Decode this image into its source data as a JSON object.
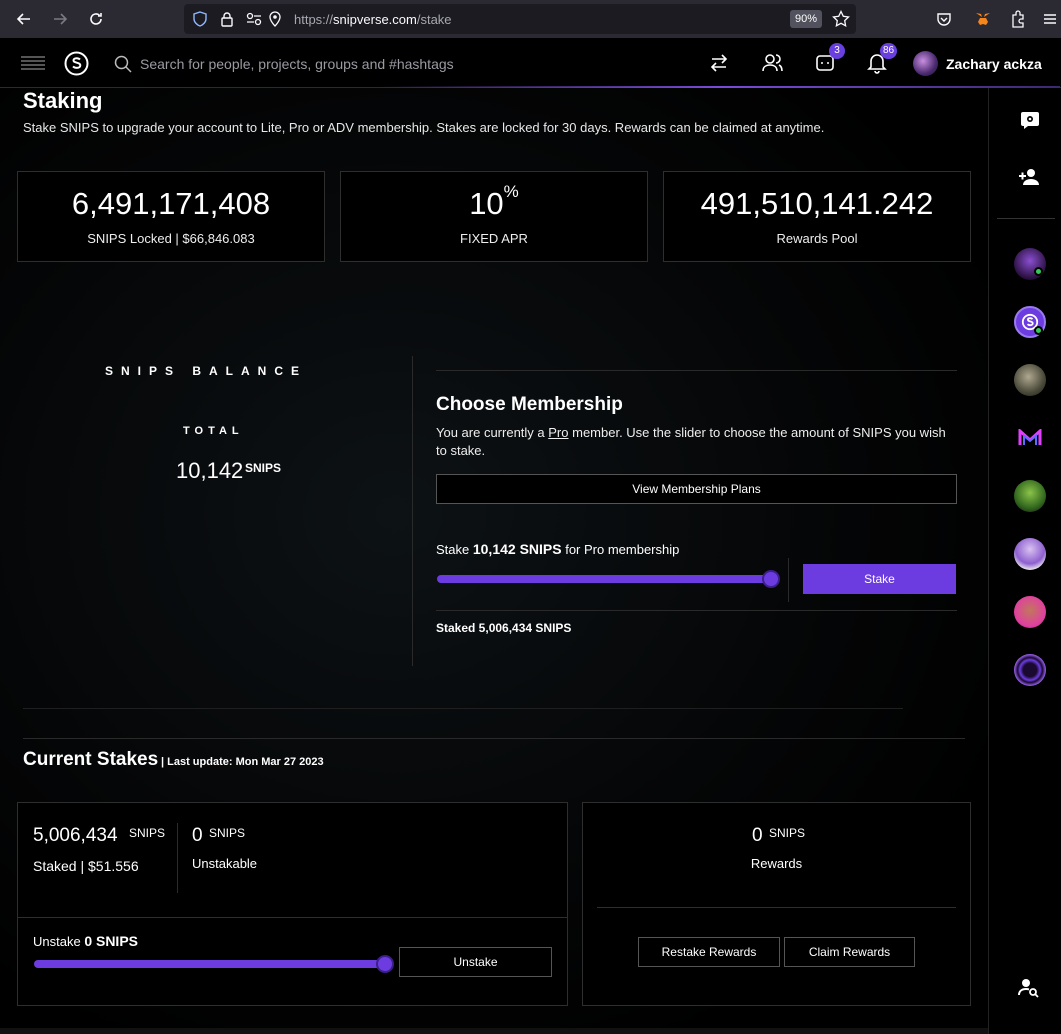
{
  "browser": {
    "url_prefix": "https://",
    "url_host": "snipverse.com",
    "url_path": "/stake",
    "zoom": "90%"
  },
  "header": {
    "search_placeholder": "Search for people, projects, groups and #hashtags",
    "messages_badge": "3",
    "notifications_badge": "86",
    "user_name": "Zachary ackza"
  },
  "staking": {
    "title": "Staking",
    "subtitle": "Stake SNIPS to upgrade your account to Lite, Pro or ADV membership. Stakes are locked for 30 days. Rewards can be claimed at anytime.",
    "stats": [
      {
        "value": "6,491,171,408",
        "label": "SNIPS Locked | $66,846.083"
      },
      {
        "value": "10",
        "sup": "%",
        "label": "FIXED APR"
      },
      {
        "value": "491,510,141.242",
        "label": "Rewards Pool"
      }
    ]
  },
  "balance": {
    "title": "SNIPS BALANCE",
    "total_label": "TOTAL",
    "total_value": "10,142",
    "unit": "SNIPS"
  },
  "membership": {
    "title": "Choose Membership",
    "desc_before": "You are currently a ",
    "desc_link": "Pro",
    "desc_after": " member. Use the slider to choose the amount of SNIPS you wish to stake.",
    "plans_button": "View Membership Plans",
    "stake_prefix": "Stake ",
    "stake_amount": "10,142 SNIPS",
    "stake_suffix": " for Pro membership",
    "stake_slider_fraction": 1.0,
    "stake_button": "Stake",
    "staked_text": "Staked 5,006,434 SNIPS"
  },
  "current_stakes": {
    "title": "Current Stakes",
    "last_update": "| Last update: Mon Mar 27 2023",
    "staked_value": "5,006,434",
    "staked_unit": "SNIPS",
    "staked_label": "Staked | $51.556",
    "unstakable_value": "0",
    "unstakable_unit": "SNIPS",
    "unstakable_label": "Unstakable",
    "unstake_prefix": "Unstake ",
    "unstake_amount": "0 SNIPS",
    "unstake_slider_fraction": 1.0,
    "unstake_button": "Unstake",
    "rewards_value": "0",
    "rewards_unit": "SNIPS",
    "rewards_label": "Rewards",
    "restake_button": "Restake Rewards",
    "claim_button": "Claim Rewards"
  },
  "colors": {
    "accent": "#6c3ce1",
    "online": "#34c759"
  }
}
